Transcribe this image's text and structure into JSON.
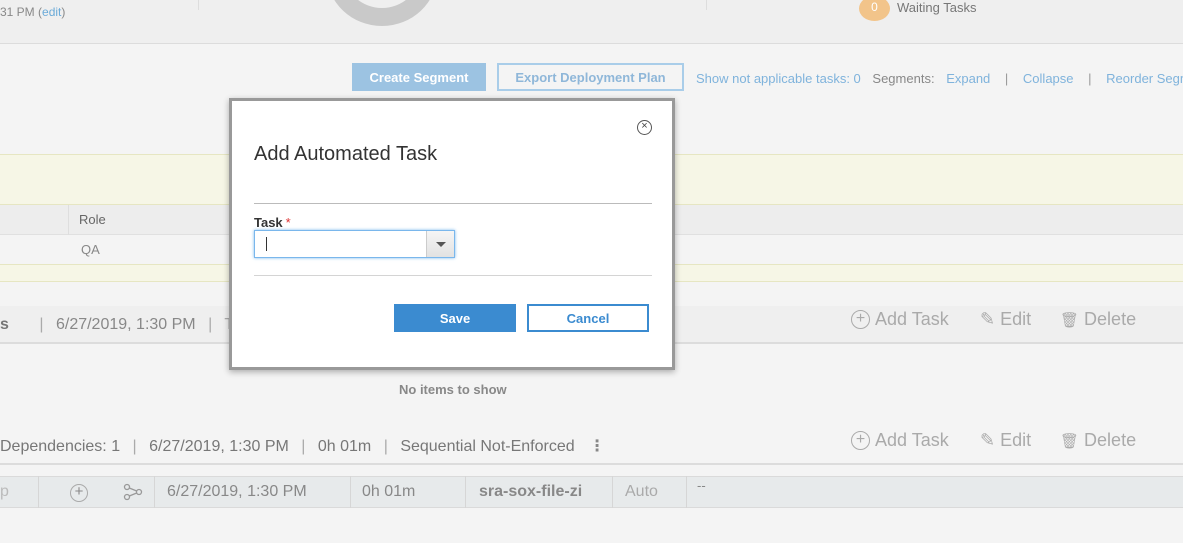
{
  "header": {
    "modified_time": "31 PM",
    "edit_link": "edit",
    "waiting_count": "0",
    "waiting_label": "Waiting Tasks"
  },
  "toolbar": {
    "create_segment": "Create Segment",
    "export_plan": "Export Deployment Plan",
    "show_not_applicable": "Show not applicable tasks: 0",
    "segments_label": "Segments:",
    "expand": "Expand",
    "collapse": "Collapse",
    "reorder": "Reorder Segme",
    "separator": "|"
  },
  "phase": {
    "role_header": "Role",
    "role_value": "QA"
  },
  "segment1": {
    "name_tail": "s",
    "separator": "|",
    "date": "6/27/2019, 1:30 PM",
    "extra": "T",
    "add_task": "Add Task",
    "edit": "Edit",
    "delete": "Delete",
    "empty_message": "No items to show"
  },
  "segment2": {
    "dependencies": "Dependencies: 1",
    "separator": "|",
    "date": "6/27/2019, 1:30 PM",
    "duration": "0h 01m",
    "mode": "Sequential Not-Enforced",
    "add_task": "Add Task",
    "edit": "Edit",
    "delete": "Delete"
  },
  "task_row": {
    "name_fragment": "p",
    "date": "6/27/2019, 1:30 PM",
    "duration": "0h 01m",
    "task_name": "sra-sox-file-zi",
    "type": "Auto",
    "trailing": "--"
  },
  "modal": {
    "title": "Add Automated Task",
    "close_glyph": "×",
    "task_label": "Task",
    "required_mark": "*",
    "task_value": "",
    "save": "Save",
    "cancel": "Cancel"
  }
}
